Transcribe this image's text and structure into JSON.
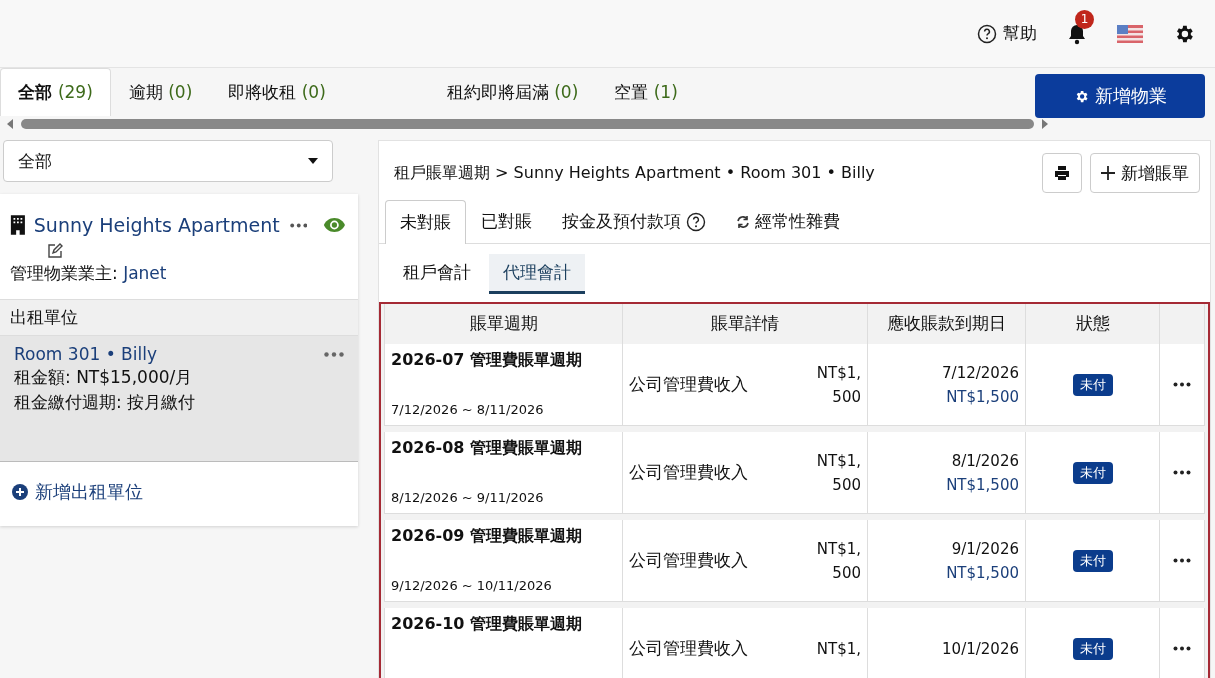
{
  "header": {
    "help": "幫助",
    "notification_count": "1"
  },
  "property_tabs": [
    {
      "label": "全部",
      "count": "(29)",
      "selected": true
    },
    {
      "label": "逾期",
      "count": "(0)",
      "selected": false
    },
    {
      "label": "即將收租",
      "count": "(0)",
      "selected": false
    },
    {
      "label": "租約即將屆滿",
      "count": "(0)",
      "selected": false
    },
    {
      "label": "空置",
      "count": "(1)",
      "selected": false
    }
  ],
  "add_property_button": "新增物業",
  "filter": {
    "value": "全部"
  },
  "property": {
    "name": "Sunny Heights Apartment",
    "owner_label": "管理物業業主:",
    "owner": "Janet",
    "units_heading": "出租單位",
    "units": [
      {
        "title": "Room 301 • Billy",
        "rent": "租金額: NT$15,000/月",
        "cycle": "租金繳付週期: 按月繳付",
        "selected": true
      }
    ],
    "add_unit": "新增出租單位"
  },
  "breadcrumb": "租戶賬單週期 > Sunny Heights Apartment • Room 301 • Billy",
  "add_bill_button": "新增賬單",
  "bill_tabs": [
    {
      "label": "未對賬",
      "selected": true,
      "kind": "plain"
    },
    {
      "label": "已對賬",
      "selected": false,
      "kind": "plain"
    },
    {
      "label": "按金及預付款項",
      "selected": false,
      "kind": "help"
    },
    {
      "label": "經常性雜費",
      "selected": false,
      "kind": "recurring"
    }
  ],
  "sub_tabs": [
    {
      "label": "租戶會計",
      "selected": false
    },
    {
      "label": "代理會計",
      "selected": true
    }
  ],
  "table": {
    "columns": [
      "賬單週期",
      "賬單詳情",
      "應收賬款到期日",
      "狀態"
    ],
    "rows": [
      {
        "period": "2026-07 管理費賬單週期",
        "range": "7/12/2026 ~ 8/11/2026",
        "detail": "公司管理費收入",
        "amount": [
          "NT$1,",
          "500"
        ],
        "due_date": "7/12/2026",
        "due_amount": "NT$1,500",
        "status": "未付"
      },
      {
        "period": "2026-08 管理費賬單週期",
        "range": "8/12/2026 ~ 9/11/2026",
        "detail": "公司管理費收入",
        "amount": [
          "NT$1,",
          "500"
        ],
        "due_date": "8/1/2026",
        "due_amount": "NT$1,500",
        "status": "未付"
      },
      {
        "period": "2026-09 管理費賬單週期",
        "range": "9/12/2026 ~ 10/11/2026",
        "detail": "公司管理費收入",
        "amount": [
          "NT$1,",
          "500"
        ],
        "due_date": "9/1/2026",
        "due_amount": "NT$1,500",
        "status": "未付"
      },
      {
        "period": "2026-10 管理費賬單週期",
        "detail": "公司管理費收入",
        "amount": [
          "NT$1,"
        ],
        "due_date": "10/1/2026",
        "status": "未付"
      }
    ]
  }
}
